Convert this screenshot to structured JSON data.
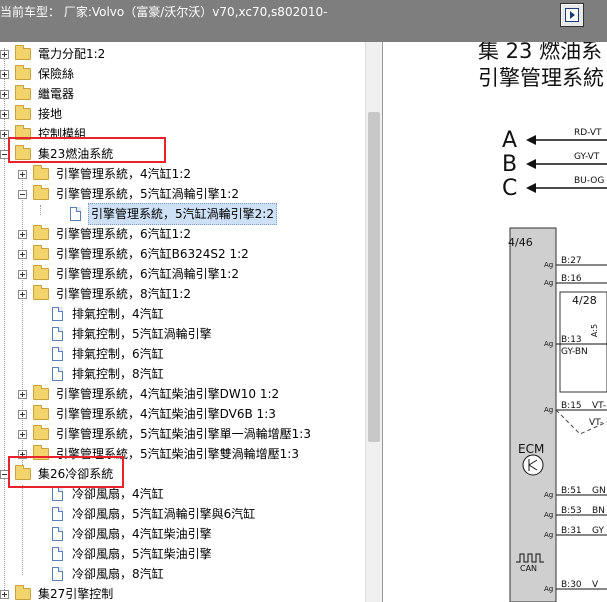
{
  "window": {
    "title": "当前车型：  厂家:Volvo（富豪/沃尔沃）v70,xc70,s802010-"
  },
  "tree": {
    "items": [
      {
        "label": "電力分配1:2",
        "type": "folder",
        "expander": "plus",
        "indent": 0
      },
      {
        "label": "保險絲",
        "type": "folder",
        "expander": "plus",
        "indent": 0
      },
      {
        "label": "繼電器",
        "type": "folder",
        "expander": "plus",
        "indent": 0
      },
      {
        "label": "接地",
        "type": "folder",
        "expander": "plus",
        "indent": 0
      },
      {
        "label": "控制模組",
        "type": "folder",
        "expander": "plus",
        "indent": 0
      },
      {
        "label": "集23燃油系統",
        "type": "folder",
        "expander": "minus",
        "indent": 0
      },
      {
        "label": "引擎管理系統，4汽缸1:2",
        "type": "folder",
        "expander": "plus",
        "indent": 1
      },
      {
        "label": "引擎管理系統，5汽缸渦輪引擎1:2",
        "type": "folder",
        "expander": "minus",
        "indent": 1
      },
      {
        "label": "引擎管理系統，5汽缸渦輪引擎2:2",
        "type": "doc",
        "expander": "none",
        "indent": 2,
        "selected": true
      },
      {
        "label": "引擎管理系統，6汽缸1:2",
        "type": "folder",
        "expander": "plus",
        "indent": 1
      },
      {
        "label": "引擎管理系統，6汽缸B6324S2 1:2",
        "type": "folder",
        "expander": "plus",
        "indent": 1
      },
      {
        "label": "引擎管理系統，6汽缸渦輪引擎1:2",
        "type": "folder",
        "expander": "plus",
        "indent": 1
      },
      {
        "label": "引擎管理系統，8汽缸1:2",
        "type": "folder",
        "expander": "plus",
        "indent": 1
      },
      {
        "label": "排氣控制，4汽缸",
        "type": "doc",
        "expander": "none",
        "indent": 1
      },
      {
        "label": "排氣控制，5汽缸渦輪引擎",
        "type": "doc",
        "expander": "none",
        "indent": 1
      },
      {
        "label": "排氣控制，6汽缸",
        "type": "doc",
        "expander": "none",
        "indent": 1
      },
      {
        "label": "排氣控制，8汽缸",
        "type": "doc",
        "expander": "none",
        "indent": 1
      },
      {
        "label": "引擎管理系統，4汽缸柴油引擎DW10 1:2",
        "type": "folder",
        "expander": "plus",
        "indent": 1
      },
      {
        "label": "引擎管理系統，4汽缸柴油引擎DV6B 1:3",
        "type": "folder",
        "expander": "plus",
        "indent": 1
      },
      {
        "label": "引擎管理系統，5汽缸柴油引擎單一渦輪增壓1:3",
        "type": "folder",
        "expander": "plus",
        "indent": 1
      },
      {
        "label": "引擎管理系統，5汽缸柴油引擎雙渦輪增壓1:3",
        "type": "folder",
        "expander": "plus",
        "indent": 1
      },
      {
        "label": "集26冷卻系統",
        "type": "folder",
        "expander": "minus",
        "indent": 0
      },
      {
        "label": "冷卻風扇，4汽缸",
        "type": "doc",
        "expander": "none",
        "indent": 1
      },
      {
        "label": "冷卻風扇，5汽缸渦輪引擎與6汽缸",
        "type": "doc",
        "expander": "none",
        "indent": 1
      },
      {
        "label": "冷卻風扇，4汽缸柴油引擎",
        "type": "doc",
        "expander": "none",
        "indent": 1
      },
      {
        "label": "冷卻風扇，5汽缸柴油引擎",
        "type": "doc",
        "expander": "none",
        "indent": 1
      },
      {
        "label": "冷卻風扇，8汽缸",
        "type": "doc",
        "expander": "none",
        "indent": 1
      },
      {
        "label": "集27引擎控制",
        "type": "folder",
        "expander": "plus",
        "indent": 0
      }
    ]
  },
  "diagram": {
    "heading_line1": "集 23 燃油系",
    "heading_line2": "引擎管理系統",
    "connectors": [
      {
        "letter": "A",
        "wire": "RD-VT"
      },
      {
        "letter": "B",
        "wire": "GY-VT"
      },
      {
        "letter": "C",
        "wire": "BU-OG"
      }
    ],
    "module_ref": "4/46",
    "sub_ref": "4/28",
    "module_name": "ECM",
    "can_label": "CAN",
    "pin_prefix": "Ag",
    "pins": [
      {
        "pin": "B:27",
        "wire": ""
      },
      {
        "pin": "B:16",
        "wire": ""
      },
      {
        "pin": "B:13",
        "wire": "GY-BN"
      },
      {
        "pin": "B:15",
        "wire": "VT-"
      },
      {
        "pin": "B:51",
        "wire": "GN"
      },
      {
        "pin": "B:53",
        "wire": "BN"
      },
      {
        "pin": "B:31",
        "wire": "GY"
      },
      {
        "pin": "B:30",
        "wire": "V"
      }
    ],
    "side_label": "A:5",
    "vt_label": "VT-"
  },
  "colors": {
    "titlebar": "#7e7e7e",
    "highlight": "#e8232b",
    "module_fill": "#cfcfcf",
    "selected": "#cde0f5"
  }
}
